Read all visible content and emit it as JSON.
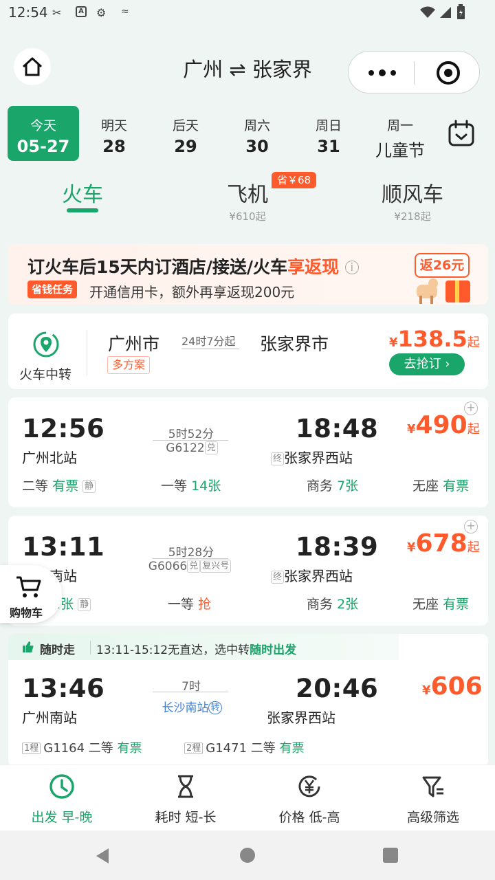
{
  "status_bar": {
    "time": "12:54"
  },
  "header": {
    "title": "广州 ⇌ 张家界"
  },
  "dates": [
    {
      "label": "今天",
      "value": "05-27",
      "selected": true
    },
    {
      "label": "明天",
      "value": "28"
    },
    {
      "label": "后天",
      "value": "29"
    },
    {
      "label": "周六",
      "value": "30"
    },
    {
      "label": "周日",
      "value": "31"
    },
    {
      "label": "周一",
      "value": "儿童节"
    }
  ],
  "modes": [
    {
      "name": "火车",
      "sub": ""
    },
    {
      "name": "飞机",
      "sub": "¥610起",
      "badge": "省￥68"
    },
    {
      "name": "顺风车",
      "sub": "¥218起"
    }
  ],
  "promo": {
    "line1_a": "订火车后15天内订酒店/接送/火车",
    "line1_b": "享返现",
    "tag": "省钱任务",
    "line2": "开通信用卡，额外再享返现200元",
    "cashback": "返26元"
  },
  "transfer": {
    "label": "火车中转",
    "from": "广州市",
    "multi": "多方案",
    "duration": "24时7分起",
    "to": "张家界市",
    "price_symbol": "¥",
    "price": "138.5",
    "price_suffix": "起",
    "button": "去抢订 ›"
  },
  "trains": [
    {
      "dep_time": "12:56",
      "dep_station": "广州北站",
      "duration": "5时52分",
      "train_no": "G6122",
      "tag": "兑",
      "tag2": "",
      "arr_time": "18:48",
      "arr_prefix": "终",
      "arr_station": "张家界西站",
      "price_symbol": "¥",
      "price": "490",
      "price_suffix": "起",
      "seats": [
        {
          "cls": "二等",
          "status": "有票",
          "extra": "静"
        },
        {
          "cls": "一等",
          "status": "14张"
        },
        {
          "cls": "商务",
          "status": "7张"
        },
        {
          "cls": "无座",
          "status": "有票"
        }
      ]
    },
    {
      "dep_time": "13:11",
      "dep_station": "广州南站",
      "duration": "5时28分",
      "train_no": "G6066",
      "tag": "兑",
      "tag2": "复兴号",
      "arr_time": "18:39",
      "arr_prefix": "终",
      "arr_station": "张家界西站",
      "price_symbol": "¥",
      "price": "678",
      "price_suffix": "起",
      "seats": [
        {
          "cls": "二等",
          "status": "2张",
          "extra": "静"
        },
        {
          "cls": "一等",
          "status": "抢"
        },
        {
          "cls": "商务",
          "status": "2张"
        },
        {
          "cls": "无座",
          "status": "有票"
        }
      ]
    }
  ],
  "cart": {
    "label": "购物车"
  },
  "flex_trip": {
    "tag": "随时走",
    "desc_a": "13:11-15:12无直达，选中转",
    "desc_b": "随时出发",
    "dep_time": "13:46",
    "dep_station": "广州南站",
    "duration": "7时",
    "via": "长沙南站",
    "via_tag": "转",
    "arr_time": "20:46",
    "arr_station": "张家界西站",
    "price_symbol": "¥",
    "price": "606",
    "legs": [
      {
        "num": "1程",
        "train": "G1164",
        "cls": "二等",
        "status": "有票"
      },
      {
        "num": "2程",
        "train": "G1471",
        "cls": "二等",
        "status": "有票"
      }
    ]
  },
  "bottom_bar": [
    {
      "label": "出发 早-晚",
      "icon": "clock-icon",
      "selected": true
    },
    {
      "label": "耗时 短-长",
      "icon": "hourglass-icon"
    },
    {
      "label": "价格 低-高",
      "icon": "yen-icon"
    },
    {
      "label": "高级筛选",
      "icon": "filter-icon"
    }
  ],
  "colors": {
    "accent": "#1aa56a",
    "price": "#ff5a2c"
  }
}
